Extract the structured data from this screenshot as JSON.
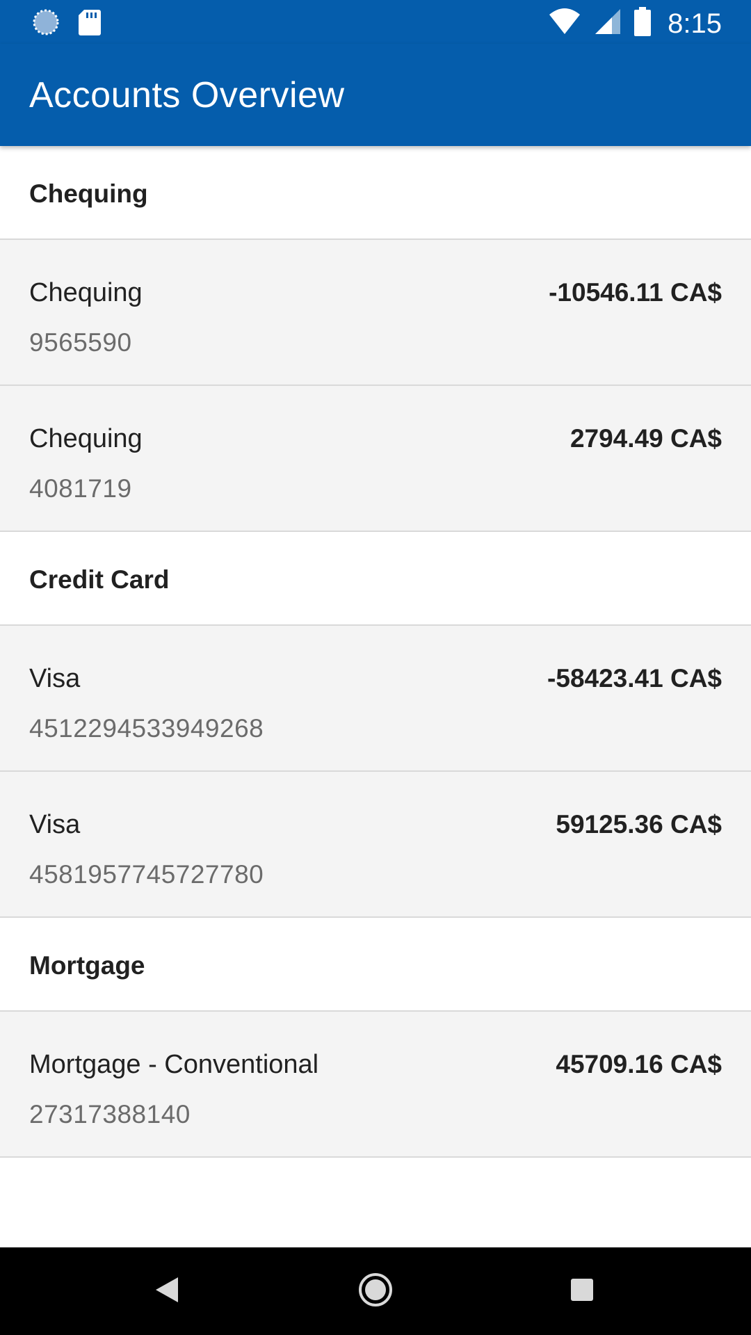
{
  "status_bar": {
    "time": "8:15",
    "icons": [
      "sync-icon",
      "sd-card-icon",
      "wifi-icon",
      "signal-icon",
      "battery-icon"
    ]
  },
  "app_bar": {
    "title": "Accounts Overview",
    "color": "#055dac"
  },
  "sections": [
    {
      "title": "Chequing",
      "accounts": [
        {
          "name": "Chequing",
          "number": "9565590",
          "balance": "-10546.11 CA$"
        },
        {
          "name": "Chequing",
          "number": "4081719",
          "balance": "2794.49 CA$"
        }
      ]
    },
    {
      "title": "Credit Card",
      "accounts": [
        {
          "name": "Visa",
          "number": "4512294533949268",
          "balance": "-58423.41 CA$"
        },
        {
          "name": "Visa",
          "number": "4581957745727780",
          "balance": "59125.36 CA$"
        }
      ]
    },
    {
      "title": "Mortgage",
      "accounts": [
        {
          "name": "Mortgage - Conventional",
          "number": "27317388140",
          "balance": "45709.16 CA$"
        }
      ]
    }
  ],
  "nav_bar": {
    "buttons": [
      "back-icon",
      "home-icon",
      "recents-icon"
    ]
  }
}
